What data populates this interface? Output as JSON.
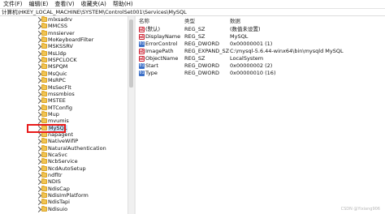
{
  "menu": [
    "文件(F)",
    "编辑(E)",
    "查看(V)",
    "收藏夹(A)",
    "帮助(H)"
  ],
  "address": "计算机\\HKEY_LOCAL_MACHINE\\SYSTEM\\ControlSet001\\Services\\MySQL",
  "tree": {
    "items": [
      {
        "label": "mlxsadrv"
      },
      {
        "label": "MMCSS"
      },
      {
        "label": "mnsierver"
      },
      {
        "label": "MoKeyboardFilter"
      },
      {
        "label": "MSKSSRV"
      },
      {
        "label": "MsLldp"
      },
      {
        "label": "MSPCLOCK"
      },
      {
        "label": "MSPQM"
      },
      {
        "label": "MsQuic"
      },
      {
        "label": "MsRPC"
      },
      {
        "label": "MsSecFlt"
      },
      {
        "label": "mssmbios"
      },
      {
        "label": "MSTEE"
      },
      {
        "label": "MTConfig"
      },
      {
        "label": "Mup"
      },
      {
        "label": "mvumis"
      },
      {
        "label": "MySQL",
        "selected": true
      },
      {
        "label": "napagent"
      },
      {
        "label": "NativeWifiP"
      },
      {
        "label": "NaturalAuthentication"
      },
      {
        "label": "NcaSvc"
      },
      {
        "label": "NcbService"
      },
      {
        "label": "NcdAutoSetup"
      },
      {
        "label": "ndfltr"
      },
      {
        "label": "NDIS"
      },
      {
        "label": "NdisCap"
      },
      {
        "label": "NdisImPlatform"
      },
      {
        "label": "NdisTapi"
      },
      {
        "label": "Ndisuio"
      }
    ]
  },
  "values": {
    "headers": {
      "name": "名称",
      "type": "类型",
      "data": "数据"
    },
    "rows": [
      {
        "icon": "string-value-icon",
        "glyph": "ab",
        "kind": "sz",
        "name": "(默认)",
        "type": "REG_SZ",
        "data": "(数值未设置)"
      },
      {
        "icon": "string-value-icon",
        "glyph": "ab",
        "kind": "sz",
        "name": "DisplayName",
        "type": "REG_SZ",
        "data": "MySQL"
      },
      {
        "icon": "dword-value-icon",
        "glyph": "01",
        "kind": "dw",
        "name": "ErrorControl",
        "type": "REG_DWORD",
        "data": "0x00000001 (1)"
      },
      {
        "icon": "string-value-icon",
        "glyph": "ab",
        "kind": "sz",
        "name": "ImagePath",
        "type": "REG_EXPAND_SZ",
        "data": "C:\\mysql-5.6.44-winx64\\bin\\mysqld MySQL"
      },
      {
        "icon": "string-value-icon",
        "glyph": "ab",
        "kind": "sz",
        "name": "ObjectName",
        "type": "REG_SZ",
        "data": "LocalSystem"
      },
      {
        "icon": "dword-value-icon",
        "glyph": "01",
        "kind": "dw",
        "name": "Start",
        "type": "REG_DWORD",
        "data": "0x00000002 (2)"
      },
      {
        "icon": "dword-value-icon",
        "glyph": "01",
        "kind": "dw",
        "name": "Type",
        "type": "REG_DWORD",
        "data": "0x00000010 (16)"
      }
    ]
  },
  "watermark": "CSDN @Yixiang906"
}
